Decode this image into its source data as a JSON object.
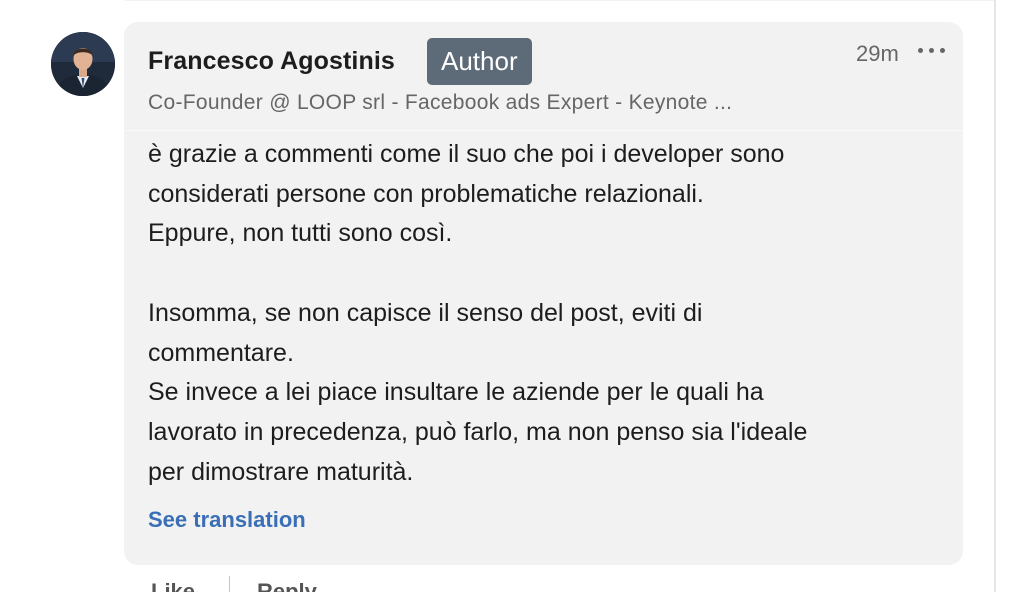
{
  "comment": {
    "author": {
      "name": "Francesco Agostinis",
      "badge": "Author",
      "headline": "Co-Founder @ LOOP srl - Facebook ads Expert - Keynote ...",
      "avatar_icon": "profile-photo"
    },
    "timestamp": "29m",
    "more_icon": "more-options-icon",
    "body_lines": [
      "è grazie a commenti come il suo che poi i developer sono",
      "considerati persone con problematiche relazionali.",
      "Eppure, non tutti sono così.",
      "",
      "Insomma, se non capisce il senso del post, eviti di",
      "commentare.",
      "Se invece a lei piace insultare le aziende per le quali ha",
      "lavorato in precedenza, può farlo, ma non penso sia l'ideale",
      "per dimostrare maturità."
    ],
    "see_translation": "See translation"
  },
  "actions": {
    "like": "Like",
    "reply": "Reply"
  },
  "colors": {
    "bubble_bg": "#f2f2f2",
    "badge_bg": "#5d6b78",
    "link": "#3a6fb5",
    "text": "#1d1d1d",
    "muted": "#666666"
  }
}
